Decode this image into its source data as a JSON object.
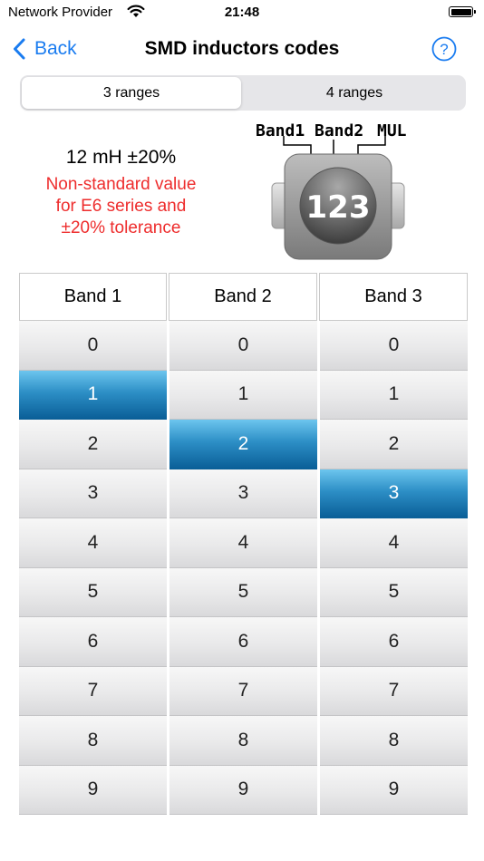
{
  "status_bar": {
    "carrier": "Network Provider",
    "time": "21:48"
  },
  "nav": {
    "back_label": "Back",
    "title": "SMD inductors codes",
    "help_label": "?"
  },
  "segmented": {
    "options": [
      "3 ranges",
      "4 ranges"
    ],
    "selected": "3 ranges"
  },
  "result": {
    "value": "12 mH ±20%",
    "note": "Non-standard value\nfor E6 series and\n±20% tolerance"
  },
  "diagram": {
    "band_labels": [
      "Band1",
      "Band2",
      "MUL"
    ],
    "code": "123"
  },
  "table": {
    "headers": [
      "Band 1",
      "Band 2",
      "Band 3"
    ],
    "digits": [
      "0",
      "1",
      "2",
      "3",
      "4",
      "5",
      "6",
      "7",
      "8",
      "9"
    ],
    "selected": [
      1,
      2,
      3
    ]
  },
  "colors": {
    "accent": "#1a7cf0",
    "warning": "#ee2d2d",
    "selected_cell": "#2d8fc6"
  }
}
